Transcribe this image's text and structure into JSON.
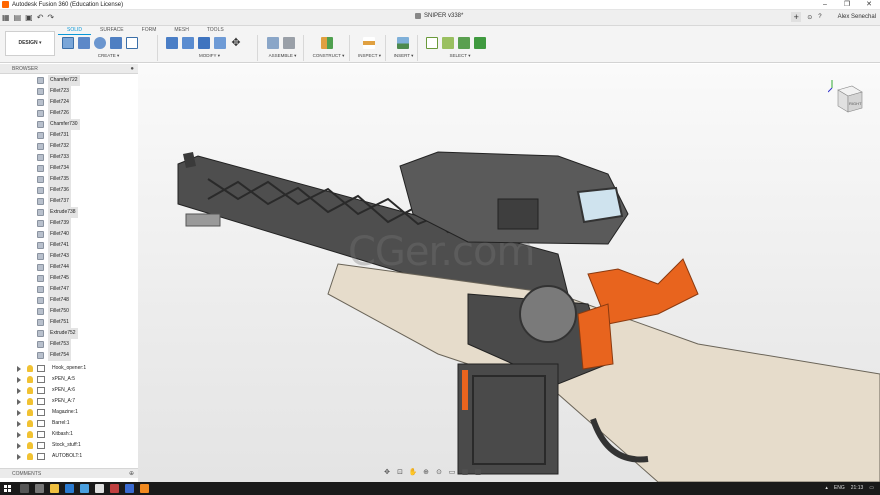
{
  "window": {
    "title": "Autodesk Fusion 360 (Education License)",
    "controls": [
      "–",
      "❐",
      "✕"
    ]
  },
  "docbar": {
    "doc_title": "SNIPER v338*",
    "user": "Alex Senechal",
    "help": "?"
  },
  "toolbar": {
    "workspace": "DESIGN ▾",
    "tabs": [
      "SOLID",
      "SURFACE",
      "FORM",
      "MESH",
      "TOOLS"
    ],
    "groups": {
      "create": "CREATE ▾",
      "modify": "MODIFY ▾",
      "assemble": "ASSEMBLE ▾",
      "construct": "CONSTRUCT ▾",
      "inspect": "INSPECT ▾",
      "insert": "INSERT ▾",
      "select": "SELECT ▾"
    }
  },
  "browser": {
    "header": "BROWSER",
    "features": [
      "Chamfer722",
      "Fillet723",
      "Fillet724",
      "Fillet726",
      "Chamfer730",
      "Fillet731",
      "Fillet732",
      "Fillet733",
      "Fillet734",
      "Fillet735",
      "Fillet736",
      "Fillet737",
      "Extrude738",
      "Fillet739",
      "Fillet740",
      "Fillet741",
      "Fillet743",
      "Fillet744",
      "Fillet745",
      "Fillet747",
      "Fillet748",
      "Fillet750",
      "Fillet751",
      "Extrude752",
      "Fillet753",
      "Fillet754"
    ],
    "components": [
      "Hook_opener:1",
      "xPEN_A:5",
      "xPEN_A:6",
      "xPEN_A:7",
      "Magazine:1",
      "Barrel:1",
      "Kitbash:1",
      "Stock_stuff:1",
      "AUTOBOLT:1"
    ]
  },
  "comments": {
    "label": "COMMENTS"
  },
  "viewport": {
    "watermark": "CGer.com",
    "viewcube_label": "RIGHT"
  },
  "taskbar": {
    "lang": "ENG",
    "time": "21:13"
  },
  "colors": {
    "accent": "#0696d7",
    "orange_parts": "#e8641e",
    "body_cream": "#e6dccb",
    "metal_dark": "#4a4a4a"
  }
}
